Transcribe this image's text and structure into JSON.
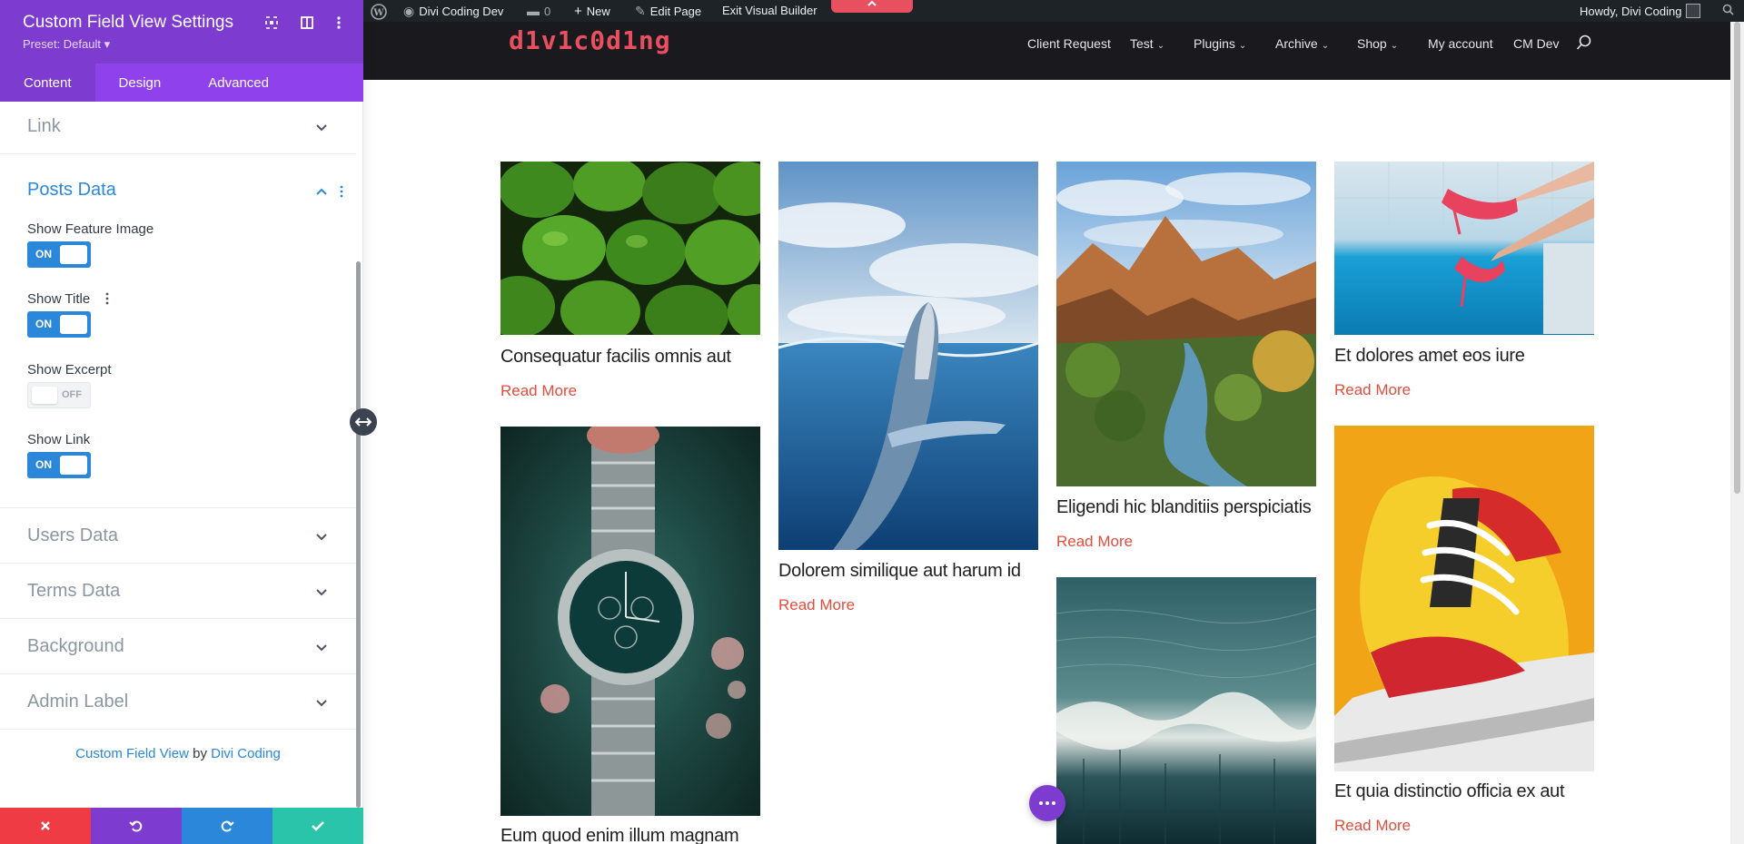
{
  "panel": {
    "title": "Custom Field View Settings",
    "preset": "Preset: Default ▾",
    "icons": [
      "expand-icon",
      "columns-icon",
      "more-icon"
    ],
    "tabs": [
      {
        "label": "Content",
        "active": true
      },
      {
        "label": "Design",
        "active": false
      },
      {
        "label": "Advanced",
        "active": false
      }
    ],
    "sections": {
      "link": "Link",
      "posts_data": "Posts Data",
      "users_data": "Users Data",
      "terms_data": "Terms Data",
      "background": "Background",
      "admin_label": "Admin Label"
    },
    "fields": [
      {
        "label": "Show Feature Image",
        "state": "ON"
      },
      {
        "label": "Show Title",
        "state": "ON"
      },
      {
        "label": "Show Excerpt",
        "state": "OFF"
      },
      {
        "label": "Show Link",
        "state": "ON"
      }
    ],
    "credit": {
      "product": "Custom Field View",
      "by": "by",
      "author": "Divi Coding"
    },
    "footer": {
      "colors": {
        "cancel": "#ef3b44",
        "undo": "#7e3bd0",
        "redo": "#2b87da",
        "save": "#29c4a9"
      }
    }
  },
  "adminbar": {
    "site": "Divi Coding Dev",
    "comments": "0",
    "new": "New",
    "edit": "Edit Page",
    "exit": "Exit Visual Builder",
    "howdy": "Howdy, Divi Coding"
  },
  "site": {
    "logo": "d1v1c0d1ng",
    "nav": [
      "Client Request",
      "Test",
      "Plugins",
      "Archive",
      "Shop",
      "My account",
      "CM Dev"
    ]
  },
  "posts": [
    {
      "title": "Consequatur facilis omnis aut",
      "more": "Read More"
    },
    {
      "title": "Dolorem similique aut harum id",
      "more": "Read More"
    },
    {
      "title": "Eligendi hic blanditiis perspiciatis",
      "more": "Read More"
    },
    {
      "title": "Et dolores amet eos iure",
      "more": "Read More"
    },
    {
      "title": "Eum quod enim illum magnam",
      "more": ""
    },
    {
      "title": "",
      "more": ""
    },
    {
      "title": "Et quia distinctio officia ex aut",
      "more": "Read More"
    }
  ],
  "colors": {
    "accent": "#7e3bd0",
    "toggle_on": "#2b87da",
    "read_more": "#e24d3c"
  }
}
